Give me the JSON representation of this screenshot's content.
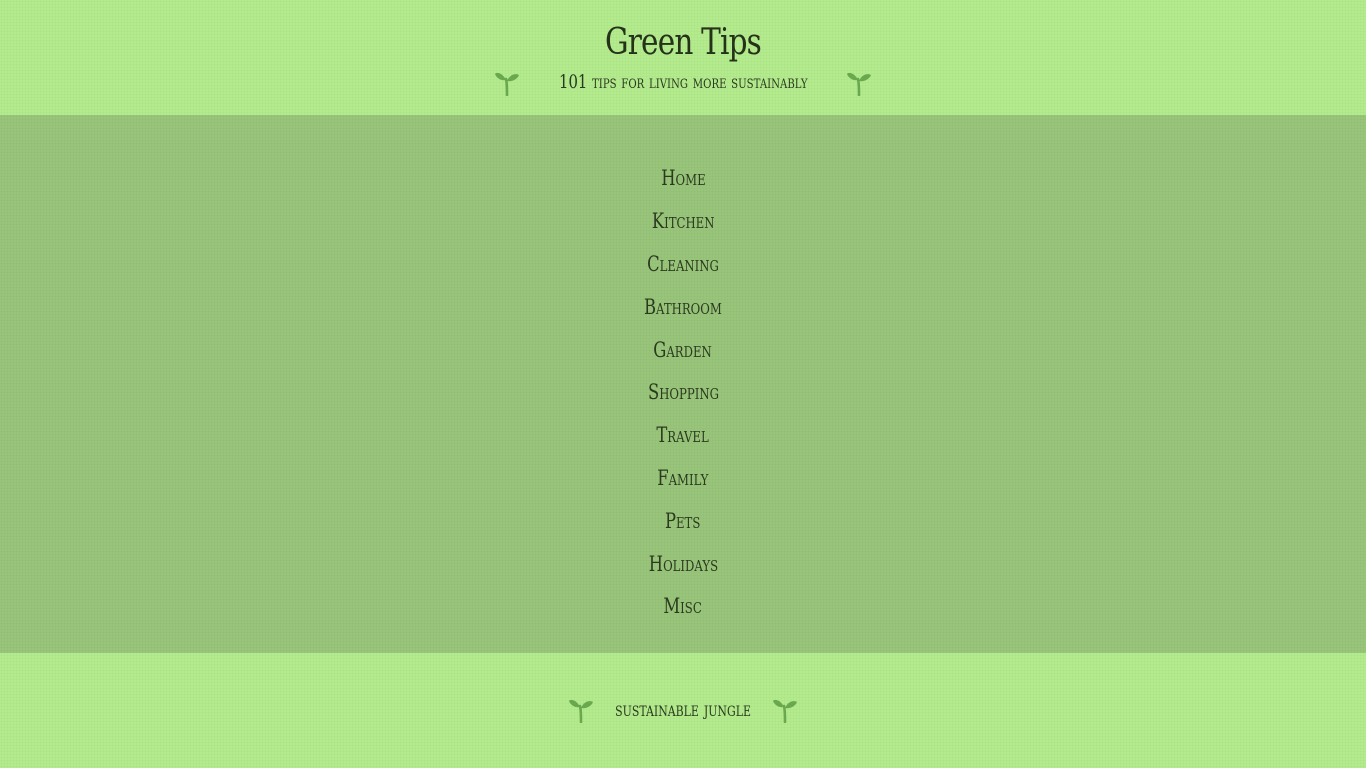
{
  "header": {
    "title": "Green Tips",
    "tagline": "101 tips for living more sustainably",
    "left_icon": "sprout-icon",
    "right_icon": "sprout-icon"
  },
  "nav": {
    "items": [
      {
        "label": "Home"
      },
      {
        "label": "Kitchen"
      },
      {
        "label": "Cleaning"
      },
      {
        "label": "Bathroom"
      },
      {
        "label": "Garden"
      },
      {
        "label": "Shopping"
      },
      {
        "label": "Travel"
      },
      {
        "label": "Family"
      },
      {
        "label": "Pets"
      },
      {
        "label": "Holidays"
      },
      {
        "label": "Misc"
      }
    ]
  },
  "footer": {
    "text": "sustainable jungle",
    "left_icon": "sprout-icon",
    "right_icon": "sprout-icon"
  },
  "colors": {
    "page_background": "#b3eb8d",
    "nav_background": "#99c57a",
    "text": "#2b3a1f",
    "sprout": "#6aa84f"
  }
}
